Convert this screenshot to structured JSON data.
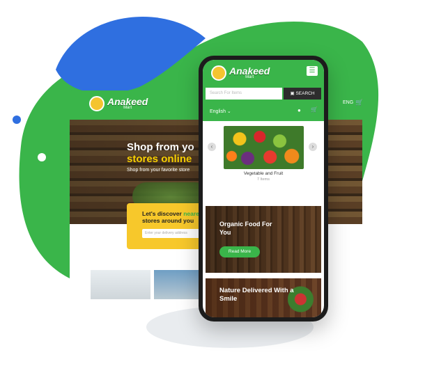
{
  "brand": {
    "name": "Anakeed",
    "sub": "Mart",
    "green": "#3ab54a",
    "yellow": "#f7d000",
    "blue": "#2f6fe0"
  },
  "desktop": {
    "lang": "ENG",
    "cart_icon": "cart-icon",
    "hero_title_1": "Shop from yo",
    "hero_title_2": "stores online",
    "hero_sub": "Shop from your favorite store",
    "discover_line1": "Let's discover",
    "discover_highlight": "neare",
    "discover_line2": "stores around you",
    "discover_placeholder": "Enter your delivery address"
  },
  "phone": {
    "menu_icon": "hamburger-icon",
    "search_placeholder": "Search For Items",
    "search_button": "SEARCH",
    "lang": "English",
    "category": {
      "name": "Vegetable and Fruit",
      "count": "7 Items"
    },
    "banner1": {
      "title": "Organic Food For You",
      "button": "Read More"
    },
    "banner2": {
      "title": "Nature Delivered With a Smile"
    }
  }
}
